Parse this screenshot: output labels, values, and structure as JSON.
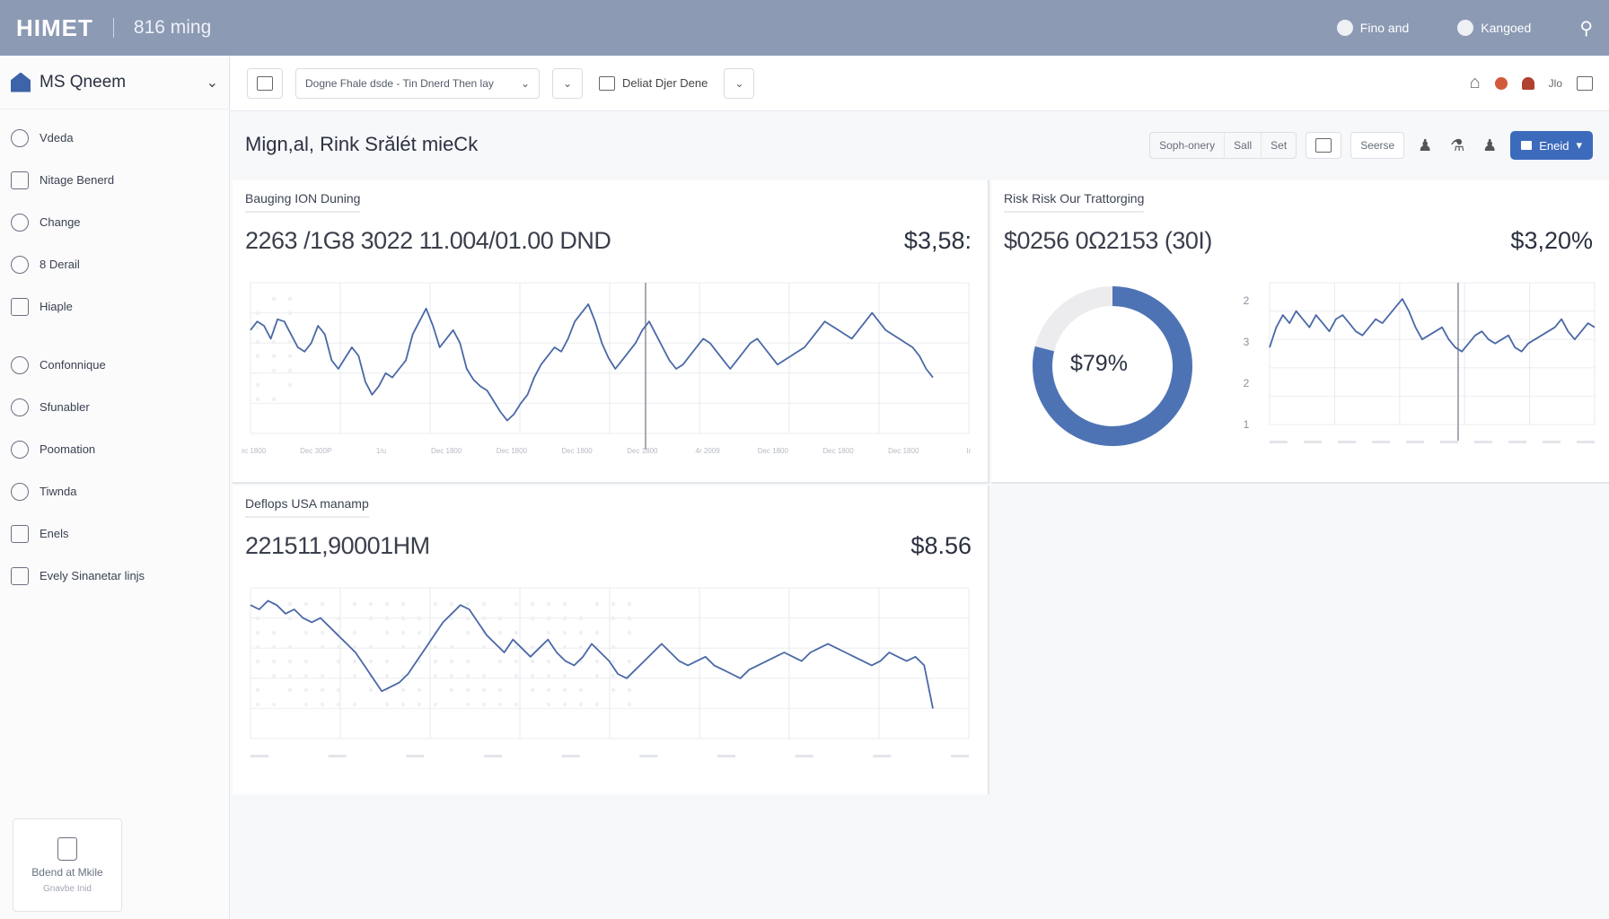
{
  "topbar": {
    "logo": "HIMET",
    "subtitle": "816 ming",
    "item1": "Fino and",
    "item2": "Kangoed"
  },
  "sidebar": {
    "org_name": "MS Qneem",
    "items": [
      {
        "label": "Vdeda",
        "icon": "info-icon"
      },
      {
        "label": "Nitage Benerd",
        "icon": "user-icon"
      },
      {
        "label": "Change",
        "icon": "user-icon"
      },
      {
        "label": "8 Derail",
        "icon": "mail-icon"
      },
      {
        "label": "Hiaple",
        "icon": "people-icon"
      },
      {
        "label": "Confonnique",
        "icon": "info-icon"
      },
      {
        "label": "Sfunabler",
        "icon": "user-icon"
      },
      {
        "label": "Poomation",
        "icon": "target-icon"
      },
      {
        "label": "Tiwnda",
        "icon": "refresh-icon"
      },
      {
        "label": "Enels",
        "icon": "trash-icon"
      },
      {
        "label": "Evely Sinanetar linjs",
        "icon": "chart-icon"
      }
    ],
    "help_title": "Bdend at Mkile",
    "help_sub": "Gnavbe Inid"
  },
  "toolbar": {
    "dropdown_value": "Dogne Fhale dsde - Tin Dnerd Then lay",
    "view_label": "Deliat Djer Dene",
    "user_short": "Jlo"
  },
  "page": {
    "title": "Mign,al, Rink Srălét mieCk",
    "seg": [
      "Soph-onery",
      "Sall",
      "Set"
    ],
    "search_btn": "Seerse",
    "primary_btn": "Eneid"
  },
  "panels": {
    "p1": {
      "title": "Bauging ION Duning",
      "value": "2263 /1G8 3022 11.004/01.00 DND",
      "right": "$3,58:"
    },
    "p2": {
      "title": "Risk Risk Our Trattorging",
      "value": "$0256 0Ω2153 (30I)",
      "right": "$3,20%",
      "donut_label": "$79%"
    },
    "p3": {
      "title": "Deflops USA manamp",
      "value": "221511,90001HM",
      "right": "$8.56"
    }
  },
  "colors": {
    "accent": "#3d6bbb",
    "line": "#4a68a6",
    "topbar": "#8c9ab4",
    "donut_track": "#ececee"
  },
  "chart_data": [
    {
      "type": "line",
      "title": "Bauging ION Duning",
      "x": [
        "Dec 1800",
        "Dec 300P",
        "1/u",
        "Dec 1800",
        "Dec 1800",
        "Dec 1800",
        "Dec 1800",
        "4r 2009",
        "Dec 1800",
        "Dec 1800",
        "Dec 1800",
        "Ir"
      ],
      "series": [
        {
          "values": [
            48,
            52,
            50,
            44,
            53,
            52,
            46,
            40,
            38,
            42,
            50,
            46,
            34,
            30,
            35,
            40,
            36,
            24,
            18,
            22,
            28,
            26,
            30,
            34,
            46,
            52,
            58,
            50,
            40,
            44,
            48,
            42,
            30,
            25,
            22,
            20,
            15,
            10,
            6,
            9,
            14,
            18,
            26,
            32,
            36,
            40,
            38,
            44,
            52,
            56,
            60,
            52,
            42,
            35,
            30,
            34,
            38,
            42,
            48,
            52,
            46,
            40,
            34,
            30,
            32,
            36,
            40,
            44,
            42,
            38,
            34,
            30,
            34,
            38,
            42,
            44,
            40,
            36,
            32,
            34,
            36,
            38,
            40,
            44,
            48,
            52,
            50,
            48,
            46,
            44,
            48,
            52,
            56,
            52,
            48,
            46,
            44,
            42,
            40,
            36,
            30,
            26
          ]
        }
      ]
    },
    {
      "type": "pie",
      "title": "Risk Risk Our Trattorging",
      "values": [
        79,
        21
      ]
    },
    {
      "type": "line",
      "y_ticks": [
        "2",
        "3",
        "2",
        "1"
      ],
      "series": [
        {
          "values": [
            38,
            48,
            54,
            50,
            56,
            52,
            48,
            54,
            50,
            46,
            52,
            54,
            50,
            46,
            44,
            48,
            52,
            50,
            54,
            58,
            62,
            56,
            48,
            42,
            44,
            46,
            48,
            42,
            38,
            36,
            40,
            44,
            46,
            42,
            40,
            42,
            44,
            38,
            36,
            40,
            42,
            44,
            46,
            48,
            52,
            46,
            42,
            46,
            50,
            48
          ]
        }
      ]
    },
    {
      "type": "line",
      "title": "Deflops USA manamp",
      "series": [
        {
          "values": [
            62,
            60,
            64,
            62,
            58,
            60,
            56,
            54,
            56,
            52,
            48,
            44,
            40,
            34,
            28,
            22,
            24,
            26,
            30,
            36,
            42,
            48,
            54,
            58,
            62,
            60,
            54,
            48,
            44,
            40,
            46,
            42,
            38,
            42,
            46,
            40,
            36,
            34,
            38,
            44,
            40,
            36,
            30,
            28,
            32,
            36,
            40,
            44,
            40,
            36,
            34,
            36,
            38,
            34,
            32,
            30,
            28,
            32,
            34,
            36,
            38,
            40,
            38,
            36,
            40,
            42,
            44,
            42,
            40,
            38,
            36,
            34,
            36,
            40,
            38,
            36,
            38,
            34,
            14
          ]
        }
      ]
    }
  ]
}
